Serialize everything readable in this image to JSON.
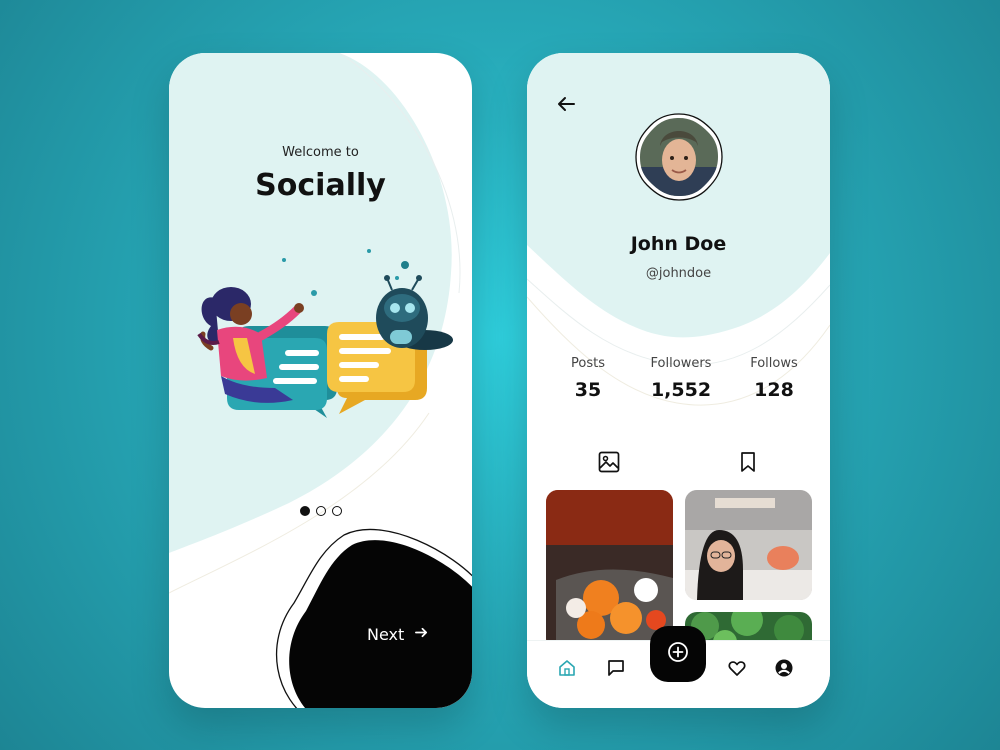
{
  "colors": {
    "background": "#27a9b8",
    "accent_light": "#dff3f2",
    "dark": "#050505"
  },
  "onboarding": {
    "subtitle": "Welcome to",
    "title": "Socially",
    "pagination": {
      "total": 3,
      "active": 1
    },
    "next_label": "Next",
    "next_icon": "arrow-right-icon"
  },
  "profile": {
    "back_icon": "arrow-left-icon",
    "name": "John Doe",
    "handle": "@johndoe",
    "stats": [
      {
        "label": "Posts",
        "value": "35"
      },
      {
        "label": "Followers",
        "value": "1,552"
      },
      {
        "label": "Follows",
        "value": "128"
      }
    ],
    "tabs": [
      {
        "icon": "image-icon",
        "active": true
      },
      {
        "icon": "bookmark-icon",
        "active": false
      }
    ],
    "nav": [
      {
        "icon": "home-icon",
        "active": true
      },
      {
        "icon": "chat-icon",
        "active": false
      },
      {
        "icon": "plus-circle-icon",
        "active": false
      },
      {
        "icon": "heart-icon",
        "active": false
      },
      {
        "icon": "user-icon",
        "active": false
      }
    ]
  }
}
